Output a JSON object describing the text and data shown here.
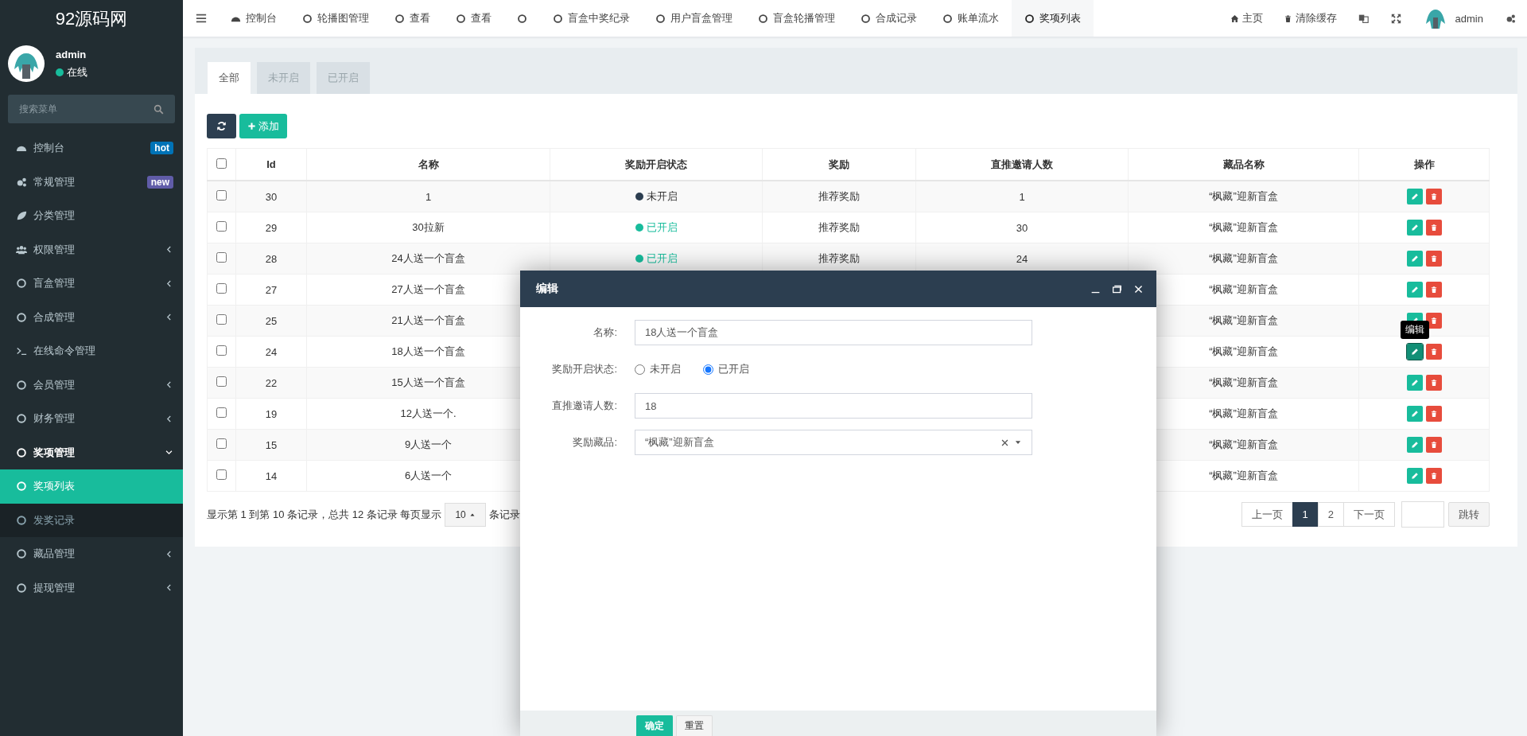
{
  "brand": {
    "title": "92源码网"
  },
  "topbar": {
    "tabs": [
      {
        "label": "控制台",
        "selected": false
      },
      {
        "label": "轮播图管理",
        "selected": false
      },
      {
        "label": "查看",
        "selected": false
      },
      {
        "label": "查看",
        "selected": false
      },
      {
        "selected": false
      },
      {
        "label": "盲盒中奖纪录",
        "selected": false
      },
      {
        "label": "用户盲盒管理",
        "selected": false
      },
      {
        "label": "盲盒轮播管理",
        "selected": false
      },
      {
        "label": "合成记录",
        "selected": false
      },
      {
        "label": "账单流水",
        "selected": false
      },
      {
        "label": "奖项列表",
        "selected": true
      }
    ],
    "links": [
      {
        "label": "主页"
      },
      {
        "label": "清除缓存"
      }
    ],
    "user": {
      "name": "admin"
    }
  },
  "sidebar": {
    "user": {
      "name": "admin",
      "status": "在线"
    },
    "search": {
      "placeholder": "搜索菜单"
    },
    "items": [
      {
        "label": "控制台",
        "kind": "link",
        "selected": false,
        "badge": {
          "text": "hot",
          "color": "#0073b7"
        }
      },
      {
        "label": "常规管理",
        "kind": "link",
        "selected": false,
        "badge": {
          "text": "new",
          "color": "#605ca8"
        }
      },
      {
        "label": "分类管理",
        "kind": "link",
        "selected": false
      },
      {
        "label": "权限管理",
        "kind": "group",
        "expanded": false,
        "selected": false
      },
      {
        "label": "盲盒管理",
        "kind": "group",
        "expanded": false,
        "selected": false
      },
      {
        "label": "合成管理",
        "kind": "group",
        "expanded": false,
        "selected": false
      },
      {
        "label": "在线命令管理",
        "kind": "link",
        "selected": false
      },
      {
        "label": "会员管理",
        "kind": "group",
        "expanded": false,
        "selected": false
      },
      {
        "label": "财务管理",
        "kind": "group",
        "expanded": false,
        "selected": false
      },
      {
        "label": "奖项管理",
        "kind": "group",
        "expanded": true,
        "selected": false,
        "children": [
          {
            "label": "奖项列表",
            "selected": true
          },
          {
            "label": "发奖记录",
            "selected": false
          }
        ]
      },
      {
        "label": "藏品管理",
        "kind": "group",
        "expanded": false,
        "selected": false
      },
      {
        "label": "提现管理",
        "kind": "group",
        "expanded": false,
        "selected": false
      }
    ]
  },
  "content": {
    "tabs": [
      {
        "label": "全部",
        "selected": true
      },
      {
        "label": "未开启",
        "selected": false
      },
      {
        "label": "已开启",
        "selected": false
      }
    ],
    "toolbar": {
      "add_label": "添加"
    },
    "table": {
      "all_checked": false,
      "tooltip": "编辑",
      "columns": [
        "Id",
        "名称",
        "奖励开启状态",
        "奖励",
        "直推邀请人数",
        "藏品名称",
        "操作"
      ],
      "rows": [
        {
          "checked": false,
          "edit_hovered": false,
          "id": "30",
          "name": "1",
          "status": {
            "on": false,
            "label": "未开启"
          },
          "reward": "推荐奖励",
          "invites": "1",
          "item": "“枫藏”迎新盲盒"
        },
        {
          "checked": false,
          "edit_hovered": false,
          "id": "29",
          "name": "30拉新",
          "status": {
            "on": true,
            "label": "已开启"
          },
          "reward": "推荐奖励",
          "invites": "30",
          "item": "“枫藏”迎新盲盒"
        },
        {
          "checked": false,
          "edit_hovered": false,
          "id": "28",
          "name": "24人送一个盲盒",
          "status": {
            "on": true,
            "label": "已开启"
          },
          "reward": "推荐奖励",
          "invites": "24",
          "item": "“枫藏”迎新盲盒"
        },
        {
          "checked": false,
          "edit_hovered": false,
          "id": "27",
          "name": "27人送一个盲盒",
          "item": "“枫藏”迎新盲盒"
        },
        {
          "checked": false,
          "edit_hovered": false,
          "id": "25",
          "name": "21人送一个盲盒",
          "item": "“枫藏”迎新盲盒"
        },
        {
          "checked": false,
          "edit_hovered": true,
          "id": "24",
          "name": "18人送一个盲盒",
          "item": "“枫藏”迎新盲盒"
        },
        {
          "checked": false,
          "edit_hovered": false,
          "id": "22",
          "name": "15人送一个盲盒",
          "item": "“枫藏”迎新盲盒"
        },
        {
          "checked": false,
          "edit_hovered": false,
          "id": "19",
          "name": "12人送一个.",
          "item": "“枫藏”迎新盲盒"
        },
        {
          "checked": false,
          "edit_hovered": false,
          "id": "15",
          "name": "9人送一个",
          "item": "“枫藏”迎新盲盒"
        },
        {
          "checked": false,
          "edit_hovered": false,
          "id": "14",
          "name": "6人送一个",
          "item": "“枫藏”迎新盲盒"
        }
      ]
    },
    "footer": {
      "summary": "显示第 1 到第 10 条记录，总共 12 条记录 每页显示",
      "page_size": "10",
      "suffix": "条记录"
    },
    "pagination": {
      "prev": "上一页",
      "pages": [
        {
          "label": "1",
          "selected": true
        },
        {
          "label": "2",
          "selected": false
        }
      ],
      "next": "下一页",
      "jump": "跳转"
    }
  },
  "modal": {
    "title": "编辑",
    "fields": [
      {
        "kind": "text",
        "label": "名称:",
        "value": "18人送一个盲盒"
      },
      {
        "kind": "radio",
        "label": "奖励开启状态:",
        "options": [
          {
            "label": "未开启",
            "selected": false
          },
          {
            "label": "已开启",
            "selected": true
          }
        ]
      },
      {
        "kind": "text",
        "label": "直推邀请人数:",
        "value": "18"
      },
      {
        "kind": "select",
        "label": "奖励藏品:",
        "value": "“枫藏”迎新盲盒"
      }
    ],
    "buttons": [
      {
        "label": "确定",
        "kind": "primary"
      },
      {
        "label": "重置",
        "kind": "default"
      }
    ]
  }
}
